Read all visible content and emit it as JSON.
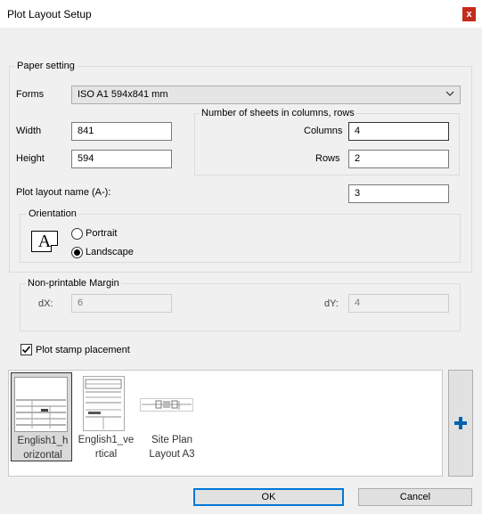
{
  "window": {
    "title": "Plot Layout Setup",
    "close_label": "x"
  },
  "paper": {
    "legend": "Paper setting",
    "forms_label": "Forms",
    "forms_value": "ISO A1 594x841 mm",
    "width_label": "Width",
    "width_value": "841",
    "height_label": "Height",
    "height_value": "594",
    "sheets_legend": "Number of sheets in columns, rows",
    "columns_label": "Columns",
    "columns_value": "4",
    "rows_label": "Rows",
    "rows_value": "2",
    "plot_name_label": "Plot layout name (A-):",
    "plot_name_value": "3"
  },
  "orientation": {
    "legend": "Orientation",
    "icon_letter": "A",
    "portrait_label": "Portrait",
    "landscape_label": "Landscape",
    "selected": "landscape"
  },
  "margin": {
    "legend": "Non-printable Margin",
    "dx_label": "dX:",
    "dx_value": "6",
    "dy_label": "dY:",
    "dy_value": "4"
  },
  "stamp": {
    "label": "Plot stamp placement",
    "checked": true
  },
  "templates": [
    {
      "line1": "English1_h",
      "line2": "orizontal",
      "selected": true
    },
    {
      "line1": "English1_ve",
      "line2": "rtical",
      "selected": false
    },
    {
      "line1": "Site Plan",
      "line2": "Layout A3",
      "selected": false
    }
  ],
  "buttons": {
    "ok": "OK",
    "cancel": "Cancel"
  },
  "colors": {
    "add_icon": "#0063b1",
    "default_button_border": "#0078d7",
    "close_button": "#c42b1c"
  }
}
